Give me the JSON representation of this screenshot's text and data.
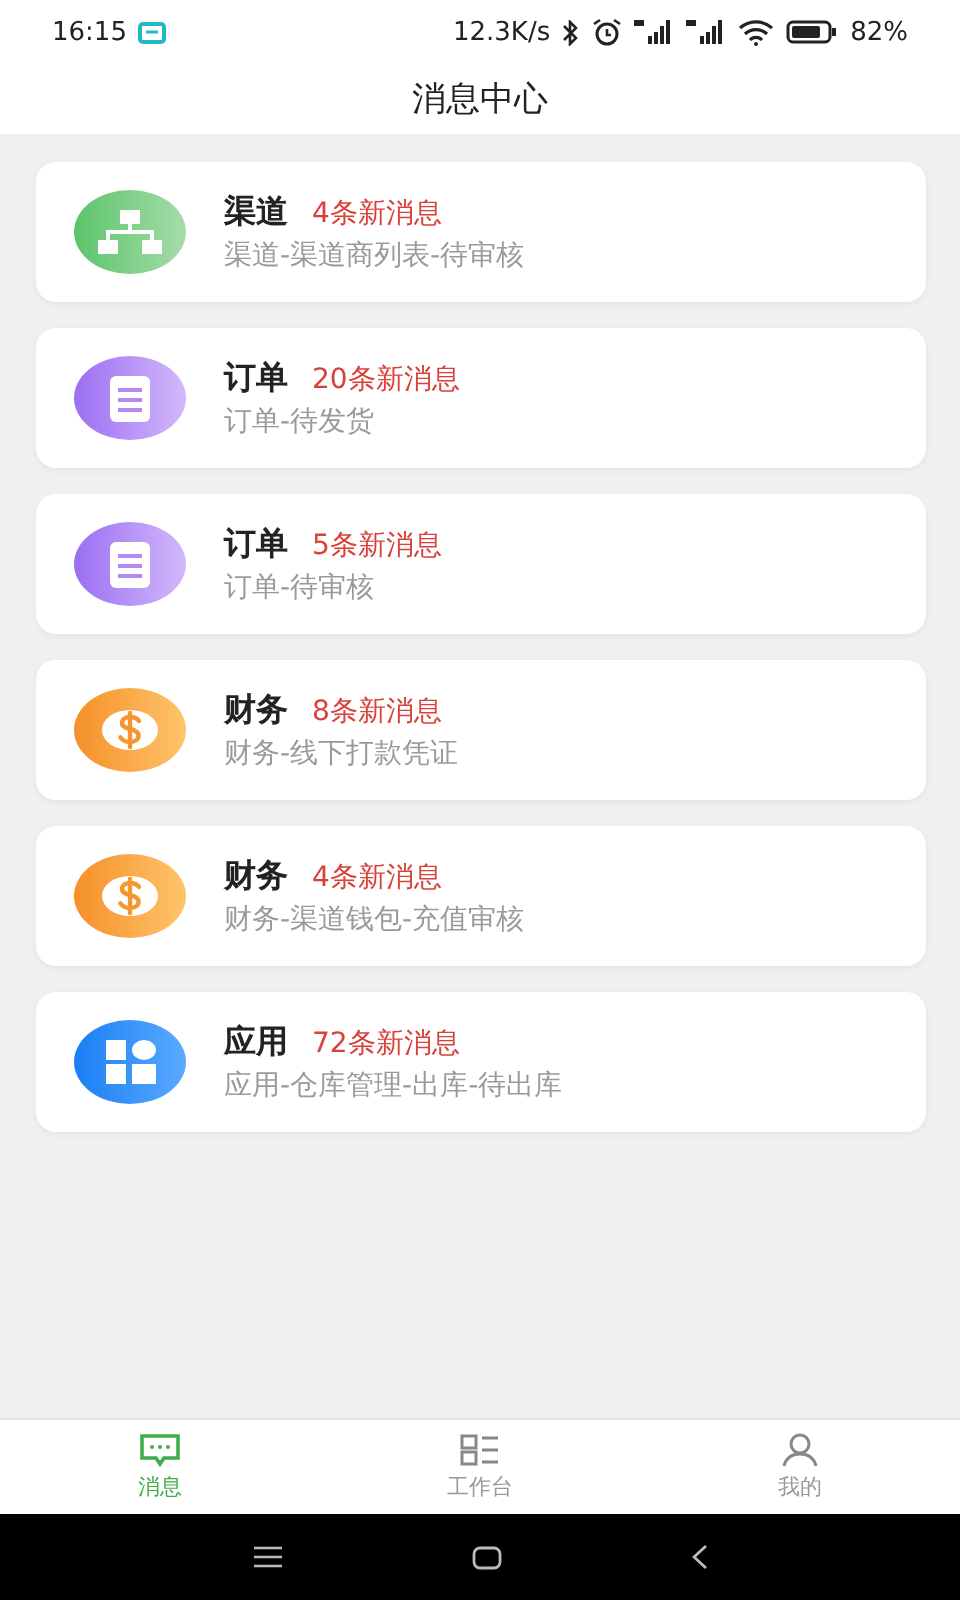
{
  "status_bar": {
    "time": "16:15",
    "speed": "12.3K/s",
    "battery": "82%"
  },
  "header": {
    "title": "消息中心"
  },
  "messages": [
    {
      "kind": "network",
      "title": "渠道",
      "count": "4条新消息",
      "detail": "渠道-渠道商列表-待审核"
    },
    {
      "kind": "notepad",
      "title": "订单",
      "count": "20条新消息",
      "detail": "订单-待发货"
    },
    {
      "kind": "notepad",
      "title": "订单",
      "count": "5条新消息",
      "detail": "订单-待审核"
    },
    {
      "kind": "dollar",
      "title": "财务",
      "count": "8条新消息",
      "detail": "财务-线下打款凭证"
    },
    {
      "kind": "dollar",
      "title": "财务",
      "count": "4条新消息",
      "detail": "财务-渠道钱包-充值审核"
    },
    {
      "kind": "apps",
      "title": "应用",
      "count": "72条新消息",
      "detail": "应用-仓库管理-出库-待出库"
    }
  ],
  "tab_bar": [
    {
      "kind": "chat",
      "label": "消息",
      "selected": true
    },
    {
      "kind": "workbench",
      "label": "工作台",
      "selected": false
    },
    {
      "kind": "person",
      "label": "我的",
      "selected": false
    }
  ]
}
